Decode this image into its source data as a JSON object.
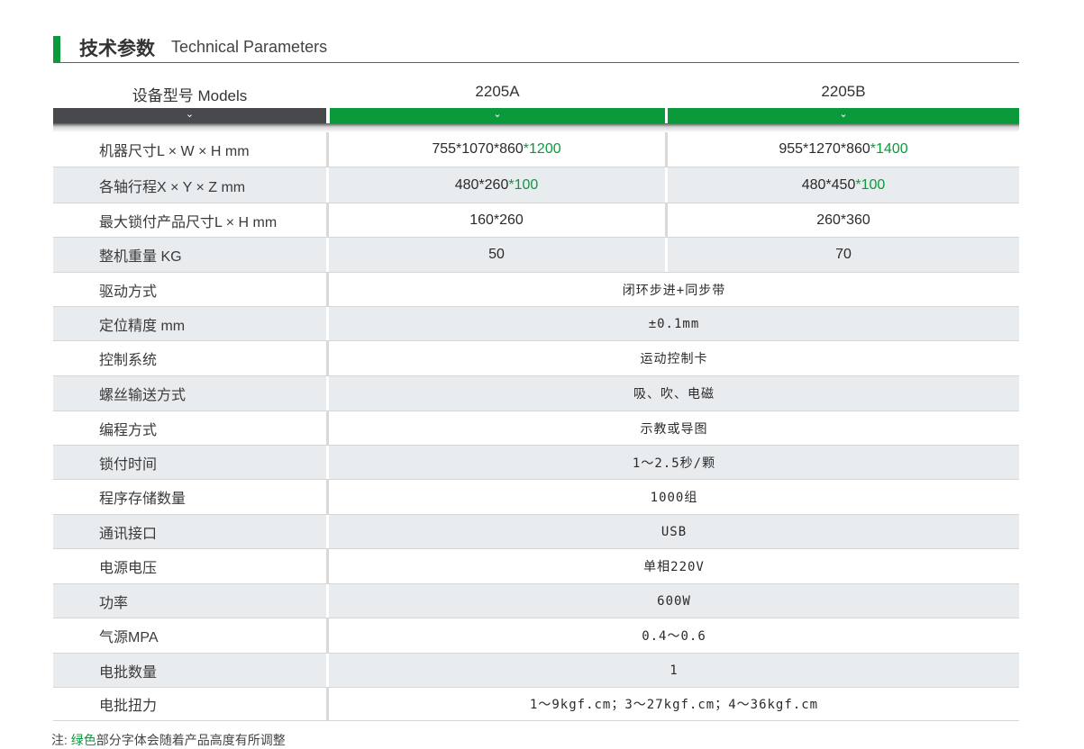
{
  "section": {
    "title_cn": "技术参数",
    "title_en": "Technical Parameters"
  },
  "table": {
    "label_header": "设备型号  Models",
    "model_a": "2205A",
    "model_b": "2205B",
    "chevron": "⌄",
    "rows_split": [
      {
        "label": "机器尺寸L × W × H mm",
        "a_main": "755*1070*860",
        "a_green": "*1200",
        "b_main": "955*1270*860",
        "b_green": "*1400"
      },
      {
        "label": "各轴行程X × Y × Z mm",
        "a_main": "480*260",
        "a_green": "*100",
        "b_main": "480*450",
        "b_green": "*100"
      },
      {
        "label": "最大锁付产品尺寸L × H mm",
        "a_main": "160*260",
        "a_green": "",
        "b_main": "260*360",
        "b_green": ""
      },
      {
        "label": "整机重量 KG",
        "a_main": "50",
        "a_green": "",
        "b_main": "70",
        "b_green": ""
      }
    ],
    "rows_merged": [
      {
        "label": "驱动方式",
        "value": "闭环步进+同步带"
      },
      {
        "label": "定位精度 mm",
        "value": "±0.1mm"
      },
      {
        "label": "控制系统",
        "value": "运动控制卡"
      },
      {
        "label": "螺丝输送方式",
        "value": "吸、吹、电磁"
      },
      {
        "label": "编程方式",
        "value": "示教或导图"
      },
      {
        "label": "锁付时间",
        "value": "1～2.5秒/颗"
      },
      {
        "label": "程序存储数量",
        "value": "1000组"
      },
      {
        "label": "通讯接口",
        "value": "USB"
      },
      {
        "label": "电源电压",
        "value": "单相220V"
      },
      {
        "label": "功率",
        "value": "600W"
      },
      {
        "label": "气源MPA",
        "value": "0.4～0.6"
      },
      {
        "label": "电批数量",
        "value": "1"
      },
      {
        "label": "电批扭力",
        "value": "1～9kgf.cm；3～27kgf.cm；4～36kgf.cm"
      }
    ],
    "colors": {
      "green": "#0a9a3c",
      "dark": "#47494c",
      "alt_row": "#e8ecef"
    }
  },
  "note": {
    "prefix": "注: ",
    "green_word": "绿色",
    "rest": "部分字体会随着产品高度有所调整"
  }
}
